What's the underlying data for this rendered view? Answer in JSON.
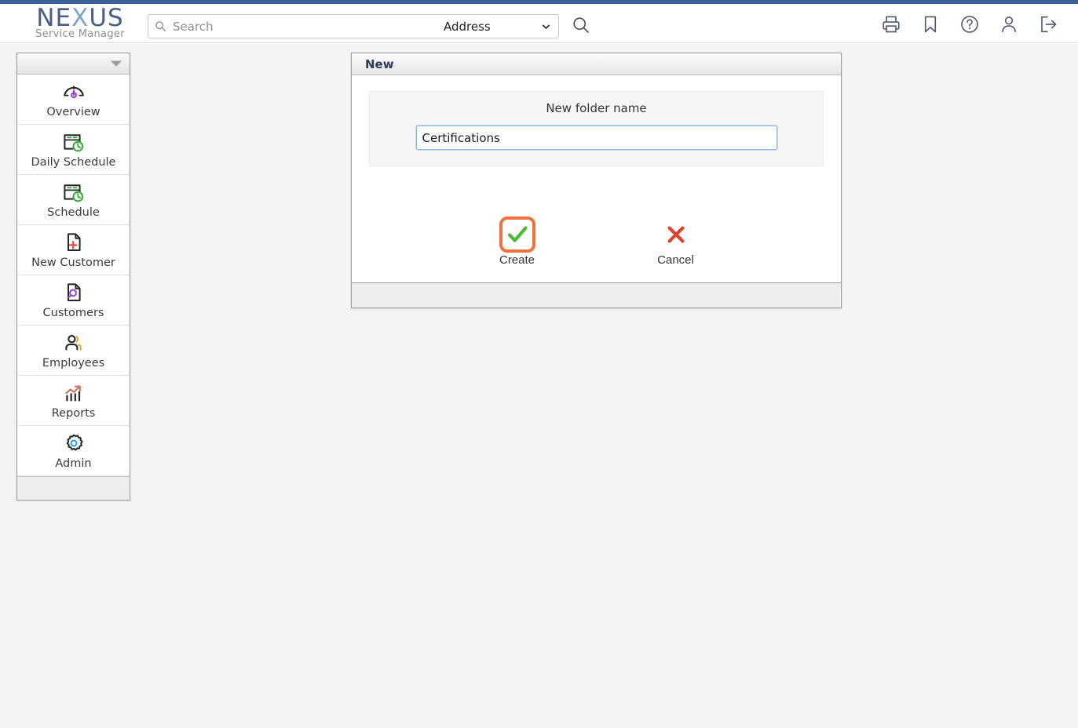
{
  "app": {
    "logo_primary_a": "NE",
    "logo_primary_x": "X",
    "logo_primary_b": "US",
    "logo_subtitle": "Service Manager",
    "brand_color": "#4b5e86",
    "brand_accent_color": "#7fa4d4",
    "top_strip_color": "#3c6196"
  },
  "header": {
    "search": {
      "placeholder": "Search",
      "value": "",
      "icon": "search-icon",
      "scope_selected": "Address",
      "scope_options": [
        "Address"
      ],
      "scope_chevron_icon": "chevron-down-icon",
      "submit_icon": "search-icon"
    },
    "icons": [
      {
        "name": "print-icon",
        "title": "Print"
      },
      {
        "name": "bookmark-icon",
        "title": "Bookmark"
      },
      {
        "name": "help-icon",
        "title": "Help"
      },
      {
        "name": "user-icon",
        "title": "User"
      },
      {
        "name": "logout-icon",
        "title": "Log out"
      }
    ]
  },
  "sidebar": {
    "collapse_icon": "chevron-down-icon",
    "items": [
      {
        "label": "Overview",
        "icon": "gauge-icon",
        "accent": "#9b3fd4"
      },
      {
        "label": "Daily Schedule",
        "icon": "calendar-clock-icon",
        "accent": "#35a835"
      },
      {
        "label": "Schedule",
        "icon": "calendar-clock-icon",
        "accent": "#35a835"
      },
      {
        "label": "New Customer",
        "icon": "document-plus-icon",
        "accent": "#e04b4b"
      },
      {
        "label": "Customers",
        "icon": "document-search-icon",
        "accent": "#9b3fd4"
      },
      {
        "label": "Employees",
        "icon": "people-icon",
        "accent": "#efa72b"
      },
      {
        "label": "Reports",
        "icon": "chart-trend-icon",
        "accent": "#d4705e"
      },
      {
        "label": "Admin",
        "icon": "gear-icon",
        "accent": "#2f9fe0"
      }
    ]
  },
  "dialog": {
    "title": "New",
    "field_label": "New folder name",
    "field_value": "Certifications",
    "field_placeholder": "",
    "buttons": [
      {
        "label": "Create",
        "icon": "checkmark-icon",
        "focused": true,
        "color": "#4cbb33",
        "focus_ring": "#f3703f"
      },
      {
        "label": "Cancel",
        "icon": "cross-icon",
        "focused": false,
        "color": "#d9442f",
        "focus_ring": ""
      }
    ]
  }
}
